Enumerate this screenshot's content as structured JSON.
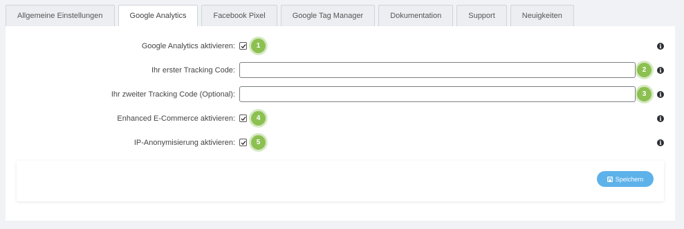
{
  "tabs": [
    {
      "label": "Allgemeine Einstellungen",
      "active": false
    },
    {
      "label": "Google Analytics",
      "active": true
    },
    {
      "label": "Facebook Pixel",
      "active": false
    },
    {
      "label": "Google Tag Manager",
      "active": false
    },
    {
      "label": "Dokumentation",
      "active": false
    },
    {
      "label": "Support",
      "active": false
    },
    {
      "label": "Neuigkeiten",
      "active": false
    }
  ],
  "form": {
    "ga_enable": {
      "label": "Google Analytics aktivieren:",
      "checked": true,
      "marker": "1"
    },
    "tracking_code_1": {
      "label": "Ihr erster Tracking Code:",
      "value": "",
      "marker": "2"
    },
    "tracking_code_2": {
      "label": "Ihr zweiter Tracking Code (Optional):",
      "value": "",
      "marker": "3"
    },
    "ecommerce_enable": {
      "label": "Enhanced E-Commerce aktivieren:",
      "checked": true,
      "marker": "4"
    },
    "ip_anonymize": {
      "label": "IP-Anonymisierung aktivieren:",
      "checked": true,
      "marker": "5"
    },
    "info_glyph": "i"
  },
  "actions": {
    "save_label": "Speichern",
    "save_icon": "floppy-disk-icon"
  },
  "colors": {
    "marker": "#8cc152",
    "save_button": "#5eb2ea",
    "background": "#f1f2f5",
    "info_icon": "#2b2e33"
  }
}
